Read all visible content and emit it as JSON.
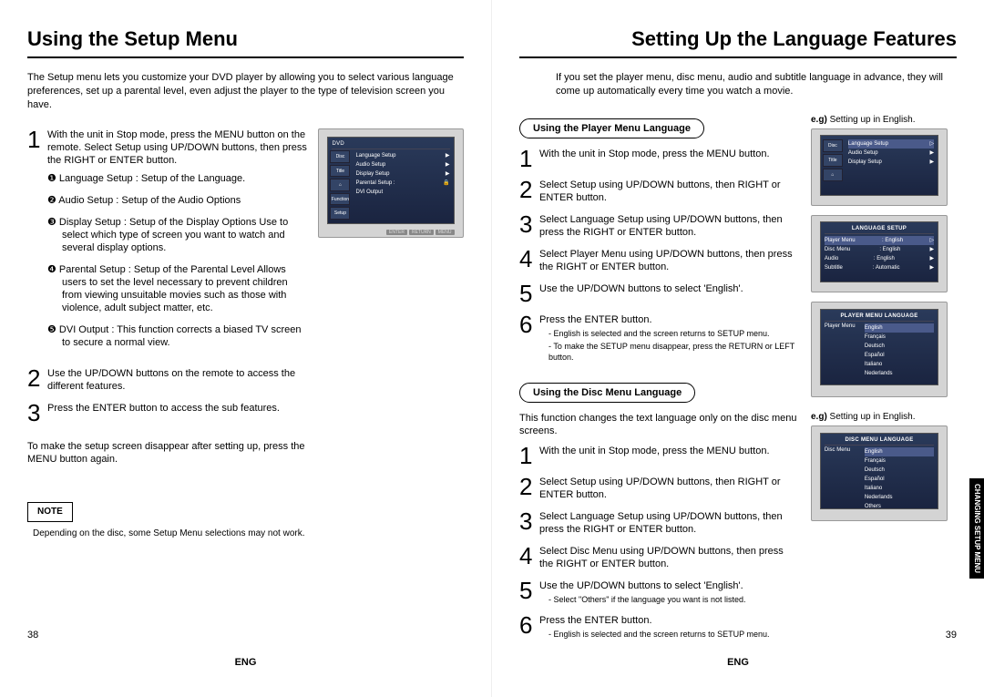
{
  "left": {
    "title": "Using the Setup Menu",
    "intro": "The Setup menu lets you customize your DVD player by allowing you to select various language preferences, set up a parental level, even adjust the player to the type of television screen you have.",
    "step1": "With the unit in Stop mode, press the MENU button on the remote. Select Setup using UP/DOWN buttons, then press the RIGHT or ENTER button.",
    "bullets": {
      "b1": "❶ Language Setup : Setup of the Language.",
      "b2": "❷ Audio Setup : Setup of the Audio Options",
      "b3": "❸ Display Setup : Setup of the Display Options Use to select which type of screen you want to watch and several display options.",
      "b4": "❹ Parental Setup : Setup of the Parental Level Allows users to set the level necessary to prevent children from viewing unsuitable movies such as those with violence, adult subject matter, etc.",
      "b5": "❺ DVI Output : This function corrects a biased TV screen to secure a normal view."
    },
    "step2": "Use the UP/DOWN buttons on the remote to access the different features.",
    "step3": "Press the ENTER button to access the sub features.",
    "closing": "To make the setup screen disappear after setting up, press the MENU button again.",
    "note_label": "NOTE",
    "note_text": "Depending on the disc, some Setup Menu selections may not work.",
    "page_num": "38",
    "footer": "ENG",
    "screen": {
      "header": "DVD",
      "icons": [
        "Disc Menu",
        "Title Menu",
        "⌂",
        "Function",
        "Setup"
      ],
      "rows": [
        "Language Setup",
        "Audio Setup",
        "Display Setup",
        "Parental Setup :",
        "DVI Output"
      ],
      "btns": [
        "ENTER",
        "RETURN",
        "MENU"
      ]
    }
  },
  "right": {
    "title": "Setting Up the Language Features",
    "intro": "If you set the player menu, disc menu, audio and subtitle language in advance, they will come up automatically every time you watch a movie.",
    "section1_title": "Using the Player Menu Language",
    "eg1": "e.g) Setting up in English.",
    "s1": {
      "t1": "With the unit in Stop mode, press the MENU button.",
      "t2": "Select Setup using UP/DOWN buttons, then RIGHT or ENTER button.",
      "t3": "Select Language Setup using UP/DOWN buttons, then press the RIGHT or ENTER button.",
      "t4": "Select Player Menu using UP/DOWN buttons, then press the RIGHT or ENTER button.",
      "t5": "Use the UP/DOWN buttons to select 'English'.",
      "t6": "Press the ENTER button.",
      "n6a": "English is selected and the screen returns to SETUP menu.",
      "n6b": "To make the SETUP menu disappear, press the RETURN or LEFT button."
    },
    "section2_title": "Using the Disc Menu Language",
    "section2_intro": "This function changes the text language only on the disc menu screens.",
    "eg2": "e.g) Setting up in English.",
    "s2": {
      "t1": "With the unit in Stop mode, press the MENU button.",
      "t2": "Select Setup using UP/DOWN buttons, then RIGHT or ENTER button.",
      "t3": "Select Language Setup using UP/DOWN buttons, then press the RIGHT or ENTER button.",
      "t4": "Select Disc Menu using UP/DOWN buttons, then press the RIGHT or ENTER button.",
      "t5": "Use the UP/DOWN buttons to select 'English'.",
      "n5": "Select \"Others\" if the language you want is not listed.",
      "t6": "Press the ENTER button.",
      "n6": "English is selected and the screen returns to SETUP menu."
    },
    "page_num": "39",
    "footer": "ENG",
    "tab": "CHANGING\nSETUP MENU",
    "fig1": {
      "header": "",
      "icons": [
        "Disc Menu",
        "Title Menu",
        "⌂"
      ],
      "rows": [
        "Language Setup",
        "Audio Setup",
        "Display Setup"
      ]
    },
    "fig2": {
      "header": "LANGUAGE SETUP",
      "rows": [
        [
          "Player Menu",
          ": English"
        ],
        [
          "Disc Menu",
          ": English"
        ],
        [
          "Audio",
          ": English"
        ],
        [
          "Subtitle",
          ": Automatic"
        ]
      ]
    },
    "fig3": {
      "header": "PLAYER MENU LANGUAGE",
      "left": "Player Menu",
      "rows": [
        "English",
        "Français",
        "Deutsch",
        "Español",
        "Italiano",
        "Nederlands"
      ]
    },
    "fig4": {
      "header": "DISC MENU LANGUAGE",
      "left": "Disc Menu",
      "rows": [
        "English",
        "Français",
        "Deutsch",
        "Español",
        "Italiano",
        "Nederlands",
        "Others"
      ]
    }
  }
}
